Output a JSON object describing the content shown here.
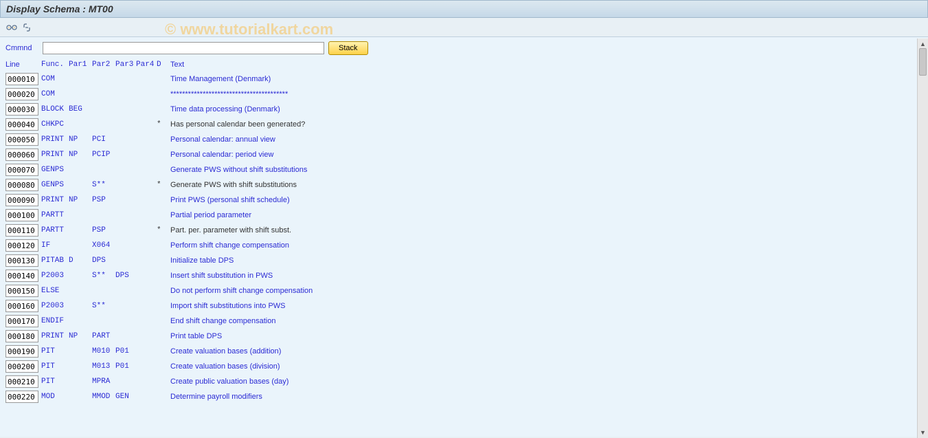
{
  "title": "Display Schema : MT00",
  "watermark": "© www.tutorialkart.com",
  "toolbar": {
    "icon1": "glasses-icon",
    "icon2": "link-icon"
  },
  "command": {
    "label": "Cmmnd",
    "value": "",
    "stack_label": "Stack"
  },
  "headers": {
    "line": "Line",
    "func": "Func.",
    "par1": "Par1",
    "par2": "Par2",
    "par3": "Par3",
    "par4": "Par4",
    "d": "D",
    "text": "Text"
  },
  "rows": [
    {
      "line": "000010",
      "func": "COM",
      "par1": "",
      "par2": "",
      "par3": "",
      "par4": "",
      "d": "",
      "text": "Time Management (Denmark)",
      "link": true
    },
    {
      "line": "000020",
      "func": "COM",
      "par1": "",
      "par2": "",
      "par3": "",
      "par4": "",
      "d": "",
      "text": "****************************************",
      "link": true
    },
    {
      "line": "000030",
      "func": "BLOCK",
      "par1": "BEG",
      "par2": "",
      "par3": "",
      "par4": "",
      "d": "",
      "text": "Time data processing (Denmark)",
      "link": true
    },
    {
      "line": "000040",
      "func": "CHKPC",
      "par1": "",
      "par2": "",
      "par3": "",
      "par4": "",
      "d": "*",
      "text": "Has personal calendar been generated?",
      "link": false
    },
    {
      "line": "000050",
      "func": "PRINT",
      "par1": "NP",
      "par2": "PCI",
      "par3": "",
      "par4": "",
      "d": "",
      "text": "Personal calendar: annual view",
      "link": true
    },
    {
      "line": "000060",
      "func": "PRINT",
      "par1": "NP",
      "par2": "PCIP",
      "par3": "",
      "par4": "",
      "d": "",
      "text": "Personal calendar: period view",
      "link": true
    },
    {
      "line": "000070",
      "func": "GENPS",
      "par1": "",
      "par2": "",
      "par3": "",
      "par4": "",
      "d": "",
      "text": "Generate PWS without shift substitutions",
      "link": true
    },
    {
      "line": "000080",
      "func": "GENPS",
      "par1": "",
      "par2": "S**",
      "par3": "",
      "par4": "",
      "d": "*",
      "text": "Generate PWS with shift substitutions",
      "link": false
    },
    {
      "line": "000090",
      "func": "PRINT",
      "par1": "NP",
      "par2": "PSP",
      "par3": "",
      "par4": "",
      "d": "",
      "text": "Print PWS (personal shift schedule)",
      "link": true
    },
    {
      "line": "000100",
      "func": "PARTT",
      "par1": "",
      "par2": "",
      "par3": "",
      "par4": "",
      "d": "",
      "text": "Partial period parameter",
      "link": true
    },
    {
      "line": "000110",
      "func": "PARTT",
      "par1": "",
      "par2": "PSP",
      "par3": "",
      "par4": "",
      "d": "*",
      "text": "Part. per. parameter with shift subst.",
      "link": false
    },
    {
      "line": "000120",
      "func": "IF",
      "par1": "",
      "par2": "X064",
      "par3": "",
      "par4": "",
      "d": "",
      "text": "Perform shift change compensation",
      "link": true
    },
    {
      "line": "000130",
      "func": "PITAB",
      "par1": "D",
      "par2": "DPS",
      "par3": "",
      "par4": "",
      "d": "",
      "text": "Initialize table DPS",
      "link": true
    },
    {
      "line": "000140",
      "func": "P2003",
      "par1": "",
      "par2": "S**",
      "par3": "DPS",
      "par4": "",
      "d": "",
      "text": "Insert shift substitution in PWS",
      "link": true
    },
    {
      "line": "000150",
      "func": "ELSE",
      "par1": "",
      "par2": "",
      "par3": "",
      "par4": "",
      "d": "",
      "text": "Do not perform shift change compensation",
      "link": true
    },
    {
      "line": "000160",
      "func": "P2003",
      "par1": "",
      "par2": "S**",
      "par3": "",
      "par4": "",
      "d": "",
      "text": "Import shift substitutions into PWS",
      "link": true
    },
    {
      "line": "000170",
      "func": "ENDIF",
      "par1": "",
      "par2": "",
      "par3": "",
      "par4": "",
      "d": "",
      "text": "End shift change compensation",
      "link": true
    },
    {
      "line": "000180",
      "func": "PRINT",
      "par1": "NP",
      "par2": "PART",
      "par3": "",
      "par4": "",
      "d": "",
      "text": "Print table DPS",
      "link": true
    },
    {
      "line": "000190",
      "func": "PIT",
      "par1": "",
      "par2": "M010",
      "par3": "P01",
      "par4": "",
      "d": "",
      "text": "Create valuation bases (addition)",
      "link": true
    },
    {
      "line": "000200",
      "func": "PIT",
      "par1": "",
      "par2": "M013",
      "par3": "P01",
      "par4": "",
      "d": "",
      "text": "Create valuation bases (division)",
      "link": true
    },
    {
      "line": "000210",
      "func": "PIT",
      "par1": "",
      "par2": "MPRA",
      "par3": "",
      "par4": "",
      "d": "",
      "text": "Create public valuation bases (day)",
      "link": true
    },
    {
      "line": "000220",
      "func": "MOD",
      "par1": "",
      "par2": "MMOD",
      "par3": "GEN",
      "par4": "",
      "d": "",
      "text": "Determine payroll modifiers",
      "link": true
    }
  ]
}
